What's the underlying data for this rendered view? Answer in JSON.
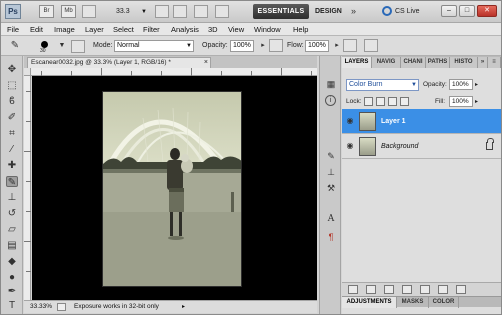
{
  "appbar": {
    "logo": "Ps",
    "br_label": "Br",
    "mb_label": "Mb",
    "zoom": "33.3",
    "workspace_active": "ESSENTIALS",
    "workspace_design": "DESIGN",
    "more": "»",
    "cs_live": "CS Live",
    "minimize": "–",
    "restore": "□",
    "close": "✕"
  },
  "menu": [
    "File",
    "Edit",
    "Image",
    "Layer",
    "Select",
    "Filter",
    "Analysis",
    "3D",
    "View",
    "Window",
    "Help"
  ],
  "options": {
    "brush_size": "30",
    "mode_label": "Mode:",
    "mode_value": "Normal",
    "opacity_label": "Opacity:",
    "opacity_value": "100%",
    "flow_label": "Flow:",
    "flow_value": "100%"
  },
  "document": {
    "tab_title": "Escanear0032.jpg @ 33.3% (Layer 1, RGB/16) *",
    "tab_close": "×",
    "zoom_status": "33.33%",
    "status_message": "Exposure works in 32-bit only"
  },
  "layers_panel": {
    "tabs": [
      "LAYERS",
      "NAVIG",
      "CHANI",
      "PATHS",
      "HISTO"
    ],
    "blend_mode": "Color Burn",
    "opacity_label": "Opacity:",
    "opacity_value": "100%",
    "lock_label": "Lock:",
    "fill_label": "Fill:",
    "fill_value": "100%",
    "layers": [
      {
        "name": "Layer 1",
        "selected": true
      },
      {
        "name": "Background",
        "selected": false
      }
    ],
    "bottom_tabs": [
      "ADJUSTMENTS",
      "MASKS",
      "COLOR"
    ]
  },
  "icons": {
    "tools": [
      "move-icon",
      "marquee-icon",
      "lasso-icon",
      "quick-select-icon",
      "crop-icon",
      "eyedropper-icon",
      "healing-icon",
      "brush-icon",
      "clone-stamp-icon",
      "history-brush-icon",
      "eraser-icon",
      "gradient-icon",
      "blur-icon",
      "dodge-icon",
      "pen-icon",
      "type-icon"
    ],
    "strip": [
      "layers-panel-icon",
      "info-icon",
      "brushes-icon",
      "clone-source-icon",
      "tool-presets-icon",
      "character-icon",
      "paragraph-icon"
    ]
  },
  "colors": {
    "selection": "#3b8fe6",
    "workspace_dark": "#2e2e2e",
    "canvas": "#000000"
  }
}
